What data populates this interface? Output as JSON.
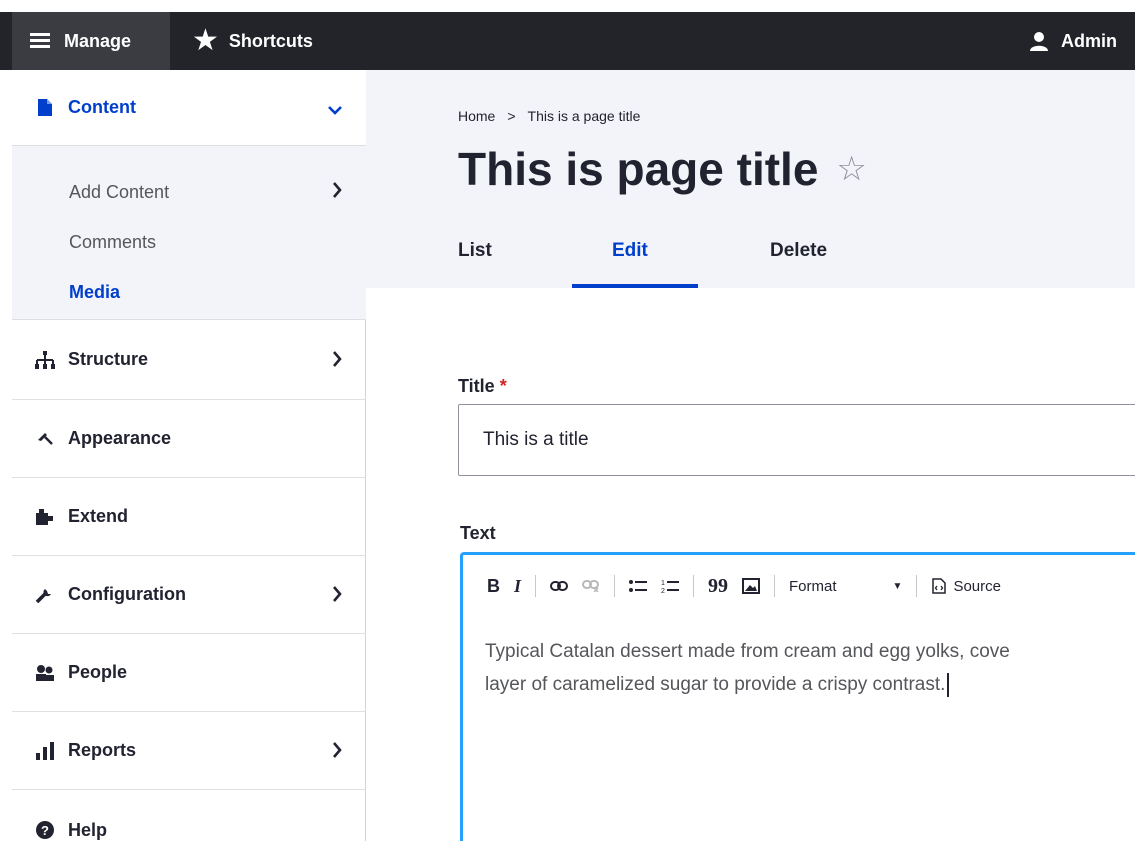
{
  "toolbar": {
    "manage_label": "Manage",
    "shortcuts_label": "Shortcuts",
    "admin_label": "Admin"
  },
  "sidebar": {
    "content": {
      "label": "Content",
      "icon": "file-icon"
    },
    "submenu": [
      {
        "label": "Add Content"
      },
      {
        "label": "Comments"
      },
      {
        "label": "Media",
        "active": true
      }
    ],
    "items": [
      {
        "label": "Structure",
        "icon": "sitemap-icon"
      },
      {
        "label": "Appearance",
        "icon": "paintbrush-icon"
      },
      {
        "label": "Extend",
        "icon": "puzzle-icon"
      },
      {
        "label": "Configuration",
        "icon": "wrench-icon"
      },
      {
        "label": "People",
        "icon": "people-icon"
      },
      {
        "label": "Reports",
        "icon": "bar-chart-icon"
      },
      {
        "label": "Help",
        "icon": "question-icon"
      }
    ]
  },
  "breadcrumb": {
    "home": "Home",
    "separator": ">",
    "current": "This is a page title"
  },
  "page": {
    "title": "This is page title"
  },
  "tabs": [
    {
      "label": "List"
    },
    {
      "label": "Edit",
      "active": true
    },
    {
      "label": "Delete"
    }
  ],
  "form": {
    "title_label": "Title",
    "required_marker": "*",
    "title_value": "This is a title",
    "text_label": "Text",
    "editor_toolbar": {
      "bold": "B",
      "italic": "I",
      "blockquote": "99",
      "format": "Format",
      "source": "Source"
    },
    "text_line1": "Typical Catalan dessert made from cream and egg yolks, cove",
    "text_line2": "layer of caramelized sugar to provide a crispy contrast."
  },
  "colors": {
    "toolbar_bg": "#232429",
    "accent": "#003ecc",
    "header_bg": "#f3f4f9",
    "editor_focus": "#26a0ff",
    "required": "#d72222"
  }
}
